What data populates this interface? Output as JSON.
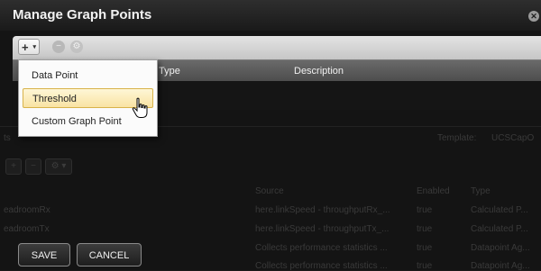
{
  "dialog": {
    "title": "Manage Graph Points",
    "close_icon": "close-icon"
  },
  "toolbar": {
    "add_icon": "plus-icon",
    "add_glyph": "+",
    "add_caret": "▾",
    "delete_icon": "minus-circle-icon",
    "delete_glyph": "−",
    "settings_icon": "gear-icon",
    "settings_glyph": "⚙"
  },
  "grid": {
    "columns": [
      "Type",
      "Description"
    ]
  },
  "menu": {
    "items": [
      {
        "label": "Data Point"
      },
      {
        "label": "Threshold"
      },
      {
        "label": "Custom Graph Point"
      }
    ],
    "hovered": "Threshold"
  },
  "background": {
    "left_label": "ts",
    "template_label": "Template:",
    "template_value": "UCSCapO",
    "tool_glyphs": [
      "+",
      "−",
      "⚙ ▾"
    ],
    "headers": [
      "Source",
      "Enabled",
      "Type"
    ],
    "rows": [
      {
        "name": "eadroomRx",
        "source": "here.linkSpeed - throughputRx_...",
        "enabled": "true",
        "type": "Calculated P..."
      },
      {
        "name": "eadroomTx",
        "source": "here.linkSpeed - throughputTx_...",
        "enabled": "true",
        "type": "Calculated P..."
      },
      {
        "name": "",
        "source": "Collects performance statistics ...",
        "enabled": "true",
        "type": "Datapoint Ag..."
      },
      {
        "name": "",
        "source": "Collects performance statistics ...",
        "enabled": "true",
        "type": "Datapoint Ag..."
      }
    ]
  },
  "footer": {
    "save_label": "SAVE",
    "cancel_label": "CANCEL"
  },
  "colors": {
    "menu_hover": "#f9e3a3",
    "toolbar": "#d5d5d5",
    "header": "#5a5a5a"
  }
}
